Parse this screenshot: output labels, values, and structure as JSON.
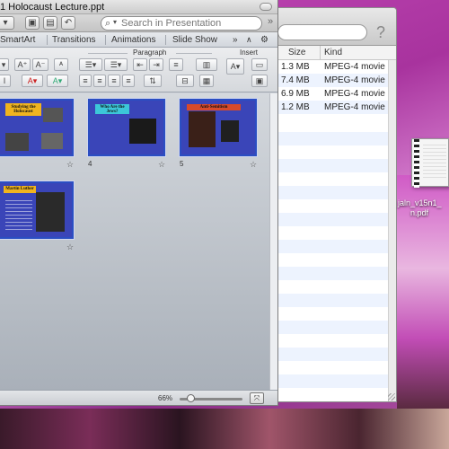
{
  "ppt": {
    "title": "1 Holocaust Lecture.ppt",
    "search_placeholder": "Search in Presentation",
    "tabs": [
      "SmartArt",
      "Transitions",
      "Animations",
      "Slide Show"
    ],
    "tab_overflow": "»",
    "ribbon_groups": {
      "paragraph": "Paragraph",
      "insert": "Insert"
    },
    "zoom": "66%",
    "slides": [
      {
        "title": "Studying the Holocaust",
        "title_bg": "#f0b41e",
        "number": ""
      },
      {
        "title": "Who Are the Jews?",
        "title_bg": "#3cc7d8",
        "number": "4"
      },
      {
        "title": "Anti-Semitism",
        "title_bg": "#d84a2a",
        "number": "5"
      },
      {
        "title": "Martin Luther",
        "title_bg": "#f0b41e",
        "number": ""
      }
    ]
  },
  "finder": {
    "columns": {
      "size": "Size",
      "kind": "Kind"
    },
    "rows": [
      {
        "size": "1.3 MB",
        "kind": "MPEG-4 movie"
      },
      {
        "size": "7.4 MB",
        "kind": "MPEG-4 movie"
      },
      {
        "size": "6.9 MB",
        "kind": "MPEG-4 movie"
      },
      {
        "size": "1.2 MB",
        "kind": "MPEG-4 movie"
      }
    ]
  },
  "desktop": {
    "file_label_line1": "jaln_v15n1_",
    "file_label_line2": "n.pdf"
  },
  "icons": {
    "help": "?",
    "search": "⌕",
    "star": "☆",
    "settings": "⚙"
  }
}
